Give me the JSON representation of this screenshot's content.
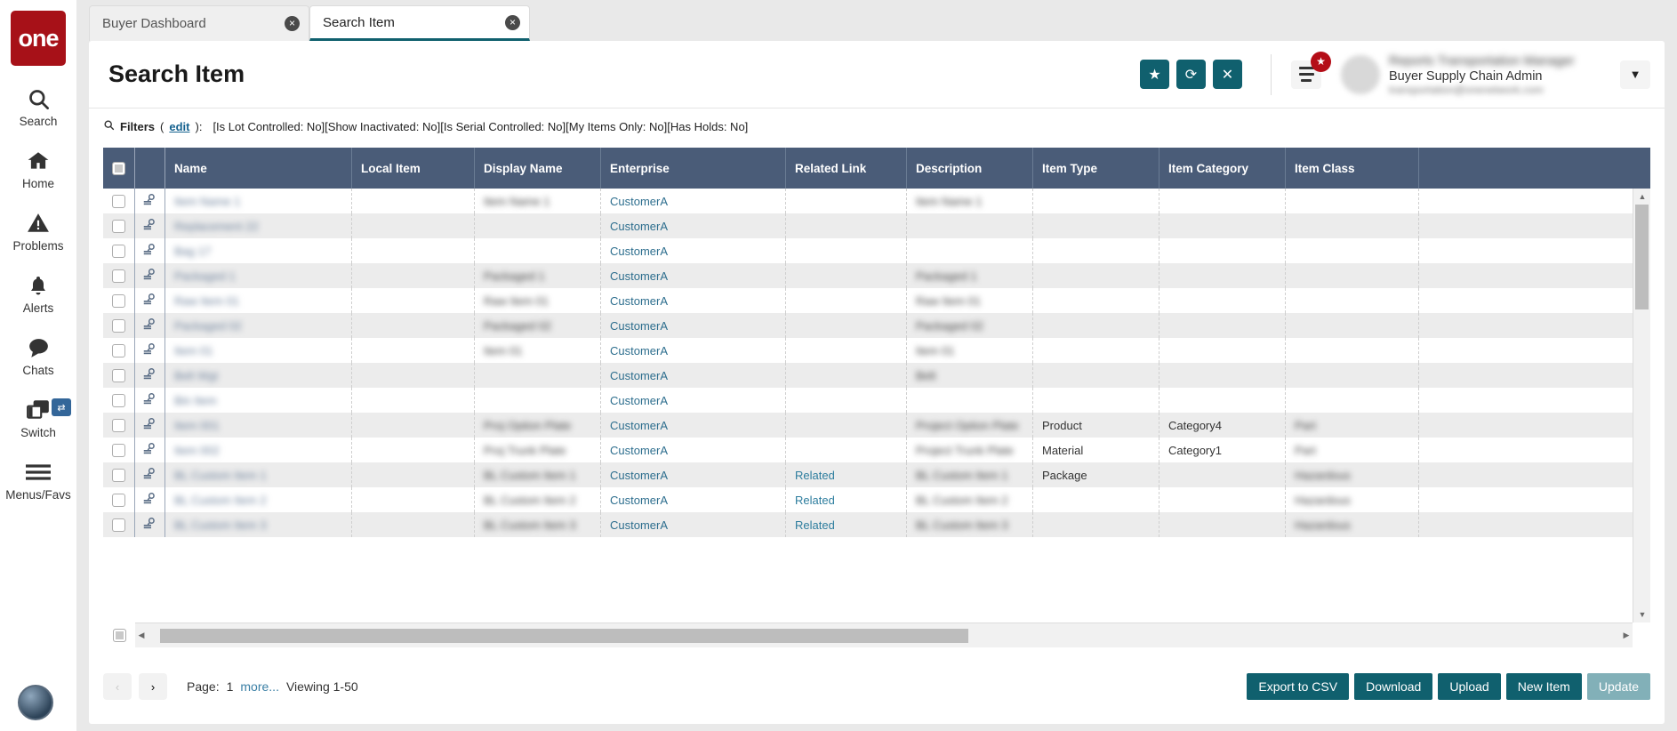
{
  "brand": {
    "logo_text": "one"
  },
  "rail": {
    "items": [
      {
        "label": "Search",
        "icon": "search-icon"
      },
      {
        "label": "Home",
        "icon": "home-icon"
      },
      {
        "label": "Problems",
        "icon": "warning-icon"
      },
      {
        "label": "Alerts",
        "icon": "bell-icon"
      },
      {
        "label": "Chats",
        "icon": "chat-icon"
      },
      {
        "label": "Switch",
        "icon": "switch-icon",
        "badge": "⇄"
      },
      {
        "label": "Menus/Favs",
        "icon": "hamburger-icon"
      }
    ]
  },
  "tabs": [
    {
      "label": "Buyer Dashboard",
      "active": false,
      "close": "×"
    },
    {
      "label": "Search Item",
      "active": true,
      "close": "×"
    }
  ],
  "header": {
    "title": "Search Item",
    "buttons": [
      {
        "name": "favorite-button",
        "glyph": "★"
      },
      {
        "name": "refresh-button",
        "glyph": "⟳"
      },
      {
        "name": "close-button",
        "glyph": "✕"
      }
    ],
    "menu_badge": "★",
    "user": {
      "name": "Reports Transportation Manager",
      "role": "Buyer Supply Chain Admin",
      "extra": "transportation@onenetwork.com",
      "caret": "❯"
    }
  },
  "filters": {
    "icon": "search-icon",
    "label": "Filters",
    "edit_open": "(",
    "edit_label": "edit",
    "edit_close": "):",
    "values": "[Is Lot Controlled: No][Show Inactivated: No][Is Serial Controlled: No][My Items Only: No][Has Holds: No]"
  },
  "table": {
    "columns": [
      "Name",
      "Local Item",
      "Display Name",
      "Enterprise",
      "Related Link",
      "Description",
      "Item Type",
      "Item Category",
      "Item Class"
    ],
    "rows": [
      {
        "name": "Item Name 1",
        "local": "",
        "display": "Item Name 1",
        "enterprise": "CustomerA",
        "related": "",
        "description": "Item Name 1",
        "type": "",
        "category": "",
        "class": "",
        "blurred": true
      },
      {
        "name": "Replacement 22",
        "local": "",
        "display": "",
        "enterprise": "CustomerA",
        "related": "",
        "description": "",
        "type": "",
        "category": "",
        "class": "",
        "blurred": true
      },
      {
        "name": "Bag 17",
        "local": "",
        "display": "",
        "enterprise": "CustomerA",
        "related": "",
        "description": "",
        "type": "",
        "category": "",
        "class": "",
        "blurred": true
      },
      {
        "name": "Packaged 1",
        "local": "",
        "display": "Packaged 1",
        "enterprise": "CustomerA",
        "related": "",
        "description": "Packaged 1",
        "type": "",
        "category": "",
        "class": "",
        "blurred": true
      },
      {
        "name": "Raw Item 01",
        "local": "",
        "display": "Raw Item 01",
        "enterprise": "CustomerA",
        "related": "",
        "description": "Raw Item 01",
        "type": "",
        "category": "",
        "class": "",
        "blurred": true
      },
      {
        "name": "Packaged 02",
        "local": "",
        "display": "Packaged 02",
        "enterprise": "CustomerA",
        "related": "",
        "description": "Packaged 02",
        "type": "",
        "category": "",
        "class": "",
        "blurred": true
      },
      {
        "name": "Item 01",
        "local": "",
        "display": "Item 01",
        "enterprise": "CustomerA",
        "related": "",
        "description": "Item 01",
        "type": "",
        "category": "",
        "class": "",
        "blurred": true
      },
      {
        "name": "Belt Wgt",
        "local": "",
        "display": "",
        "enterprise": "CustomerA",
        "related": "",
        "description": "Belt",
        "type": "",
        "category": "",
        "class": "",
        "blurred": true
      },
      {
        "name": "Bin Item",
        "local": "",
        "display": "",
        "enterprise": "CustomerA",
        "related": "",
        "description": "",
        "type": "",
        "category": "",
        "class": "",
        "blurred": true
      },
      {
        "name": "Item 001",
        "local": "",
        "display": "Proj Option Plate",
        "enterprise": "CustomerA",
        "related": "",
        "description": "Project Option Plate",
        "type": "Product",
        "category": "Category4",
        "class": "Part",
        "blurred": true
      },
      {
        "name": "Item 002",
        "local": "",
        "display": "Proj Trunk Plate",
        "enterprise": "CustomerA",
        "related": "",
        "description": "Project Trunk Plate",
        "type": "Material",
        "category": "Category1",
        "class": "Part",
        "blurred": true
      },
      {
        "name": "BL Custom Item 1",
        "local": "",
        "display": "BL Custom Item 1",
        "enterprise": "CustomerA",
        "related": "Related",
        "description": "BL Custom Item 1",
        "type": "Package",
        "category": "",
        "class": "Hazardous",
        "blurred": true
      },
      {
        "name": "BL Custom Item 2",
        "local": "",
        "display": "BL Custom Item 2",
        "enterprise": "CustomerA",
        "related": "Related",
        "description": "BL Custom Item 2",
        "type": "",
        "category": "",
        "class": "Hazardous",
        "blurred": true
      },
      {
        "name": "BL Custom Item 3",
        "local": "",
        "display": "BL Custom Item 3",
        "enterprise": "CustomerA",
        "related": "Related",
        "description": "BL Custom Item 3",
        "type": "",
        "category": "",
        "class": "Hazardous",
        "blurred": true
      }
    ]
  },
  "footer": {
    "prev": "‹",
    "next": "›",
    "page_label": "Page:",
    "page_number": "1",
    "more": "more...",
    "viewing": "Viewing 1-50",
    "actions": [
      {
        "label": "Export to CSV",
        "muted": false
      },
      {
        "label": "Download",
        "muted": false
      },
      {
        "label": "Upload",
        "muted": false
      },
      {
        "label": "New Item",
        "muted": false
      },
      {
        "label": "Update",
        "muted": true
      }
    ]
  },
  "colors": {
    "accent": "#10606e",
    "brand": "#a71118",
    "header_row": "#4a5c78",
    "link": "#2d7d9e"
  }
}
